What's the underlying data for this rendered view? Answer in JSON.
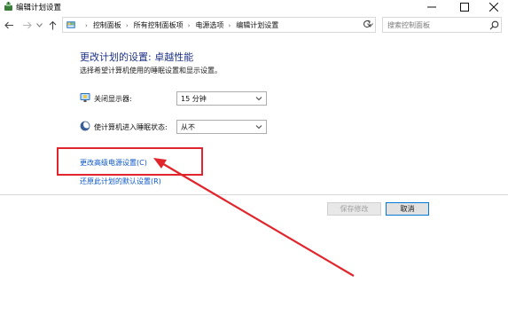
{
  "window": {
    "title": "编辑计划设置",
    "icon": "power-options-icon",
    "controls": [
      "minimize-icon",
      "maximize-icon",
      "close-icon"
    ]
  },
  "nav": {
    "breadcrumb": [
      "控制面板",
      "所有控制面板项",
      "电源选项",
      "编辑计划设置"
    ],
    "search_placeholder": "搜索控制面板"
  },
  "content": {
    "heading": "更改计划的设置: 卓越性能",
    "subheading": "选择希望计算机使用的睡眠设置和显示设置。",
    "settings": [
      {
        "label": "关闭显示器:",
        "value": "15 分钟",
        "icon": "monitor-icon"
      },
      {
        "label": "使计算机进入睡眠状态:",
        "value": "从不",
        "icon": "moon-icon"
      }
    ],
    "links": {
      "advanced": "更改高级电源设置(C)",
      "restore": "还原此计划的默认设置(R)"
    },
    "buttons": {
      "save": "保存修改",
      "cancel": "取消"
    }
  },
  "annotation": {
    "highlight_color": "#e0262c"
  }
}
